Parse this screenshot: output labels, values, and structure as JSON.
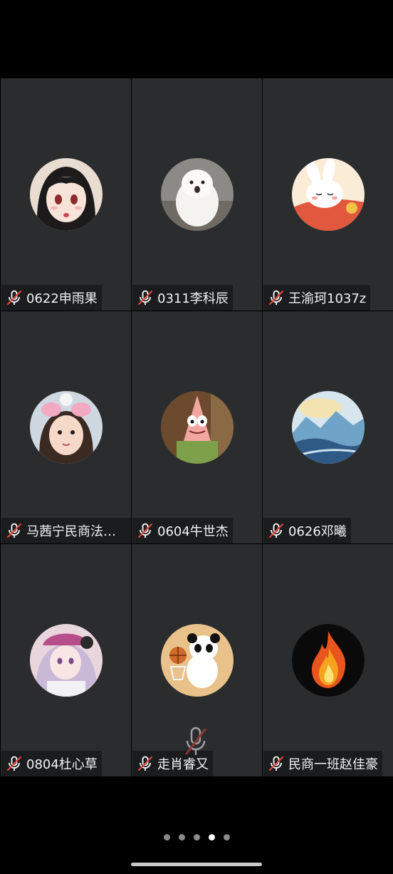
{
  "participants": [
    {
      "name": "0622申雨果",
      "avatar": "anime-girl-avatar",
      "muted": true
    },
    {
      "name": "0311李科辰",
      "avatar": "white-dog-avatar",
      "muted": true
    },
    {
      "name": "王渝珂1037z",
      "avatar": "sleeping-bunny-avatar",
      "muted": true
    },
    {
      "name": "马茜宁民商法学…",
      "avatar": "little-girl-avatar",
      "muted": true
    },
    {
      "name": "0604牛世杰",
      "avatar": "patrick-star-avatar",
      "muted": true
    },
    {
      "name": "0626邓曦",
      "avatar": "landscape-painting-avatar",
      "muted": true
    },
    {
      "name": "0804杜心草",
      "avatar": "anime-baseball-girl-avatar",
      "muted": true
    },
    {
      "name": "走肖睿又",
      "avatar": "panda-basketball-avatar",
      "muted": true
    },
    {
      "name": "民商一班赵佳豪",
      "avatar": "flame-avatar",
      "muted": true
    }
  ],
  "pager": {
    "total": 5,
    "active_index": 3
  },
  "icons": {
    "mic": "mic-off-icon",
    "center": "mic-off-icon"
  },
  "colors": {
    "tile_bg": "#2b2c2e",
    "tag_bg": "#1b1c1e",
    "mute_red": "#e0453a"
  }
}
